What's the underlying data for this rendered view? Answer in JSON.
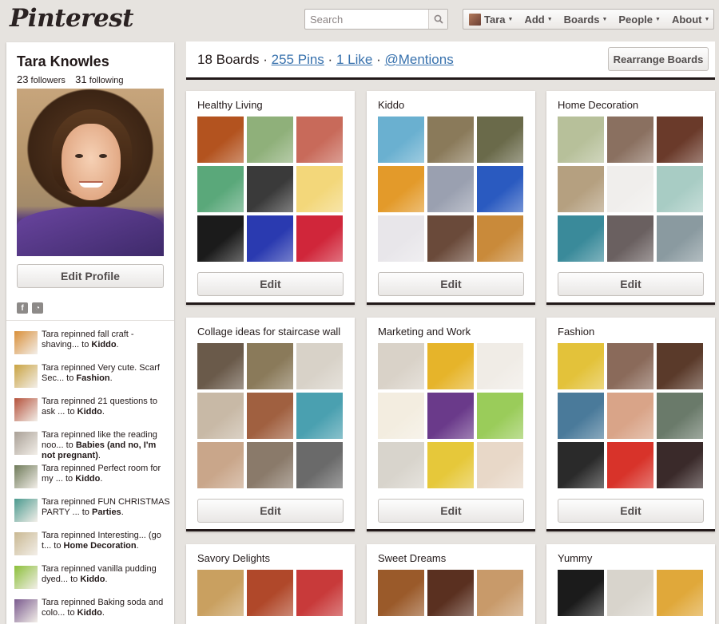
{
  "header": {
    "logo": "Pinterest",
    "search_placeholder": "Search",
    "nav": {
      "user": "Tara",
      "add": "Add",
      "boards": "Boards",
      "people": "People",
      "about": "About"
    }
  },
  "profile": {
    "name": "Tara Knowles",
    "followers_count": "23",
    "followers_label": "followers",
    "following_count": "31",
    "following_label": "following",
    "edit_label": "Edit Profile"
  },
  "activity": [
    {
      "prefix": "Tara repinned fall craft - shaving... to ",
      "board": "Kiddo",
      "suffix": ".",
      "color": "#d9903a"
    },
    {
      "prefix": "Tara repinned Very cute. Scarf Sec... to ",
      "board": "Fashion",
      "suffix": ".",
      "color": "#c9a342"
    },
    {
      "prefix": "Tara repinned 21 questions to ask ... to ",
      "board": "Kiddo",
      "suffix": ".",
      "color": "#b5523c"
    },
    {
      "prefix": "Tara repinned like the reading noo... to ",
      "board": "Babies (and no, I'm not pregnant)",
      "suffix": ".",
      "color": "#a9a096"
    },
    {
      "prefix": "Tara repinned Perfect room for my ... to ",
      "board": "Kiddo",
      "suffix": ".",
      "color": "#6f7b5a"
    },
    {
      "prefix": "Tara repinned FUN CHRISTMAS PARTY ... to ",
      "board": "Parties",
      "suffix": ".",
      "color": "#4b9a8f"
    },
    {
      "prefix": "Tara repinned Interesting... (go t... to ",
      "board": "Home Decoration",
      "suffix": ".",
      "color": "#c9b892"
    },
    {
      "prefix": "Tara repinned vanilla pudding dyed... to ",
      "board": "Kiddo",
      "suffix": ".",
      "color": "#8cbf3a"
    },
    {
      "prefix": "Tara repinned Baking soda and colo... to ",
      "board": "Kiddo",
      "suffix": ".",
      "color": "#7a5a8e"
    }
  ],
  "mainbar": {
    "boards_text": "18 Boards",
    "pins_link": "255 Pins",
    "likes_link": "1 Like",
    "mentions_link": "@Mentions",
    "separator": "·",
    "rearrange_label": "Rearrange Boards"
  },
  "boards": [
    {
      "title": "Healthy Living",
      "edit": "Edit",
      "tiles": [
        "#b3531f",
        "#8fb07a",
        "#c86a5a",
        "#5aa87a",
        "#3a3a3a",
        "#f3d77a",
        "#1b1b1b",
        "#2a3ab0",
        "#d0263a"
      ]
    },
    {
      "title": "Kiddo",
      "edit": "Edit",
      "tiles": [
        "#6ab0d0",
        "#8a7a5a",
        "#6a6a4a",
        "#e39a2a",
        "#9aa0b0",
        "#2a5ac0",
        "#e8e6ea",
        "#6a4a3a",
        "#c98a3a"
      ]
    },
    {
      "title": "Home Decoration",
      "edit": "Edit",
      "tiles": [
        "#b7c09a",
        "#8a7060",
        "#6a3a2a",
        "#b5a080",
        "#f0eeec",
        "#a8ccc4",
        "#3a8a9a",
        "#6a6060",
        "#8a9aa0"
      ]
    },
    {
      "title": "Collage ideas for staircase wall",
      "edit": "Edit",
      "tiles": [
        "#6a5a4a",
        "#8a7a5a",
        "#d8d2c8",
        "#c8b9a6",
        "#a06040",
        "#4aa0b0",
        "#c9a68a",
        "#8a7a6a",
        "#6a6a6a"
      ]
    },
    {
      "title": "Marketing and Work",
      "edit": "Edit",
      "tiles": [
        "#d9d2c8",
        "#e6b42a",
        "#f0ece6",
        "#f3ede0",
        "#6a3a8a",
        "#9acc5a",
        "#d8d4cc",
        "#e6c83a",
        "#e8d8c8"
      ]
    },
    {
      "title": "Fashion",
      "edit": "Edit",
      "tiles": [
        "#e3c23a",
        "#8a6a5a",
        "#5a3a2a",
        "#4a7a9a",
        "#d9a488",
        "#6a7a6a",
        "#2a2a2a",
        "#d8332a",
        "#3a2a2a"
      ]
    },
    {
      "title": "Savory Delights",
      "edit": "Edit",
      "tiles": [
        "#c9a060",
        "#b0482a",
        "#c83a3a"
      ]
    },
    {
      "title": "Sweet Dreams",
      "edit": "Edit",
      "tiles": [
        "#9a5a2a",
        "#5a3020",
        "#c89a6a"
      ]
    },
    {
      "title": "Yummy",
      "edit": "Edit",
      "tiles": [
        "#1b1b1b",
        "#d8d4cc",
        "#e0a83a"
      ]
    }
  ]
}
